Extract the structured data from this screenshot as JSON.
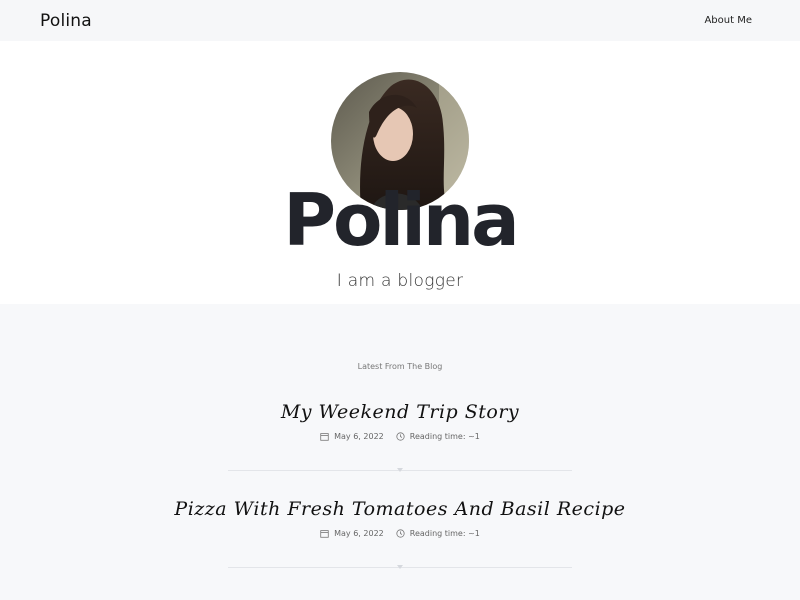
{
  "header": {
    "brand": "Polina",
    "nav_items": [
      {
        "label": "About Me"
      }
    ]
  },
  "hero": {
    "title": "Polina",
    "subtitle": "I am a blogger",
    "avatar_alt": "profile photo"
  },
  "blog": {
    "section_label": "Latest From The Blog",
    "posts": [
      {
        "title": "My Weekend Trip Story",
        "date": "May 6, 2022",
        "reading_time": "Reading time: ~1"
      },
      {
        "title": "Pizza With Fresh Tomatoes And Basil Recipe",
        "date": "May 6, 2022",
        "reading_time": "Reading time: ~1"
      }
    ]
  },
  "colors": {
    "page_bg": "#f7f8fa",
    "hero_bg": "#ffffff",
    "title_dark": "#22242b",
    "divider": "#e3e5e9"
  },
  "icons": [
    "calendar-icon",
    "clock-icon",
    "chevron-down-icon"
  ]
}
